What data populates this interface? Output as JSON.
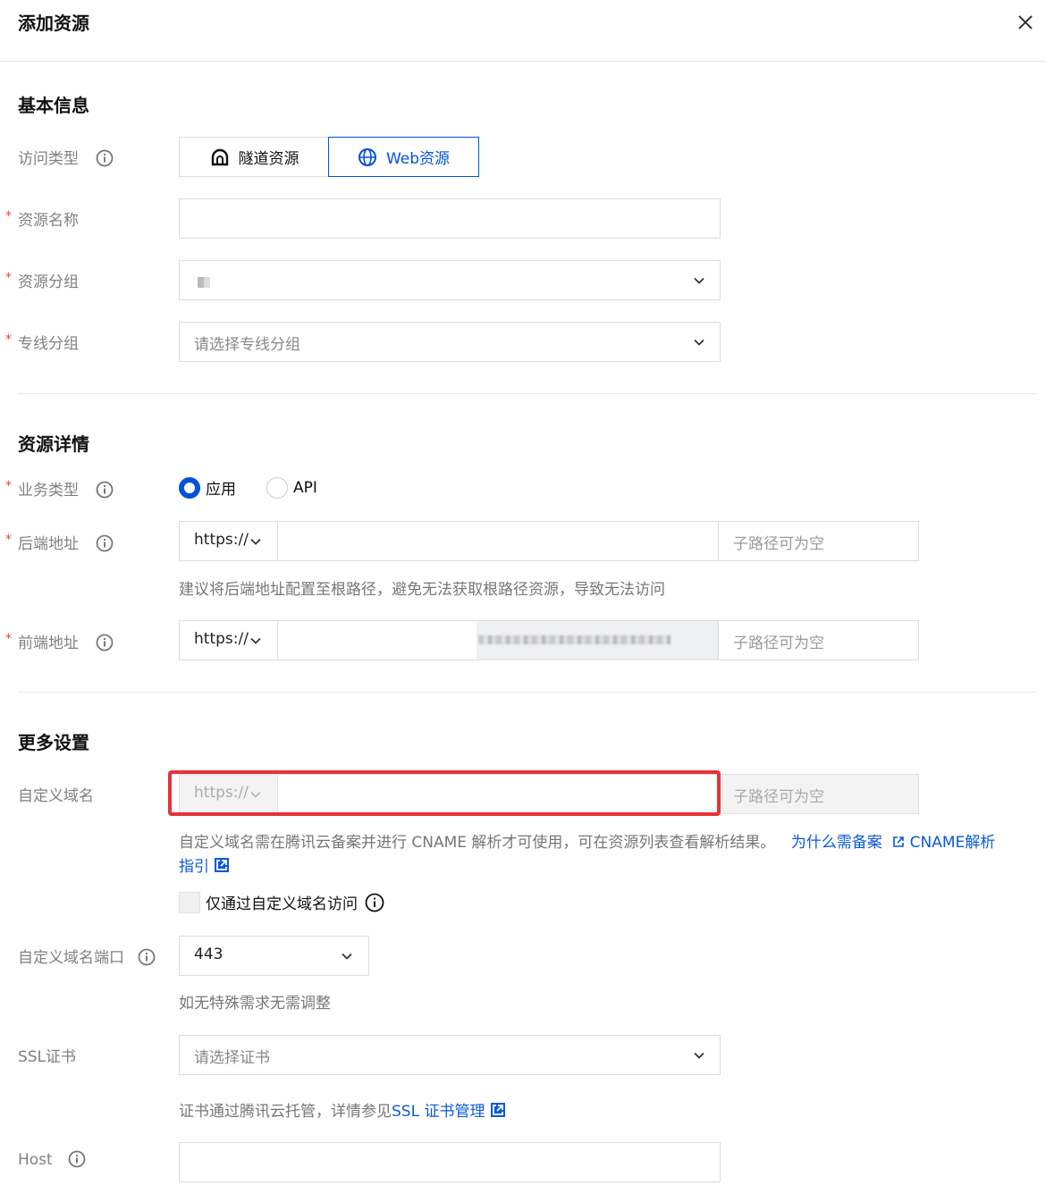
{
  "dialog": {
    "title": "添加资源"
  },
  "basic": {
    "title": "基本信息",
    "access_type_label": "访问类型",
    "access_options": [
      "隧道资源",
      "Web资源"
    ],
    "resource_name_label": "资源名称",
    "resource_group_label": "资源分组",
    "line_group_label": "专线分组",
    "line_group_placeholder": "请选择专线分组"
  },
  "detail": {
    "title": "资源详情",
    "business_type_label": "业务类型",
    "business_options": [
      "应用",
      "API"
    ],
    "backend_label": "后端地址",
    "backend_protocol": "https://",
    "backend_subpath_placeholder": "子路径可为空",
    "backend_hint": "建议将后端地址配置至根路径，避免无法获取根路径资源，导致无法访问",
    "frontend_label": "前端地址",
    "frontend_protocol": "https://",
    "frontend_subpath_placeholder": "子路径可为空"
  },
  "more": {
    "title": "更多设置",
    "custom_domain_label": "自定义域名",
    "custom_domain_protocol": "https://",
    "custom_domain_subpath_placeholder": "子路径可为空",
    "custom_domain_hint": "自定义域名需在腾讯云备案并进行 CNAME 解析才可使用，可在资源列表查看解析结果。",
    "why_filing_link": "为什么需备案",
    "cname_link_a": "CNAME解析",
    "cname_link_b": "指引",
    "only_custom_label": "仅通过自定义域名访问",
    "port_label": "自定义域名端口",
    "port_value": "443",
    "port_hint": "如无特殊需求无需调整",
    "ssl_label": "SSL证书",
    "ssl_placeholder": "请选择证书",
    "ssl_hint": "证书通过腾讯云托管，详情参见",
    "ssl_link": "SSL 证书管理",
    "host_label": "Host"
  },
  "colors": {
    "primary": "#0052d9",
    "required": "#e54545",
    "highlight": "#e8313a"
  }
}
